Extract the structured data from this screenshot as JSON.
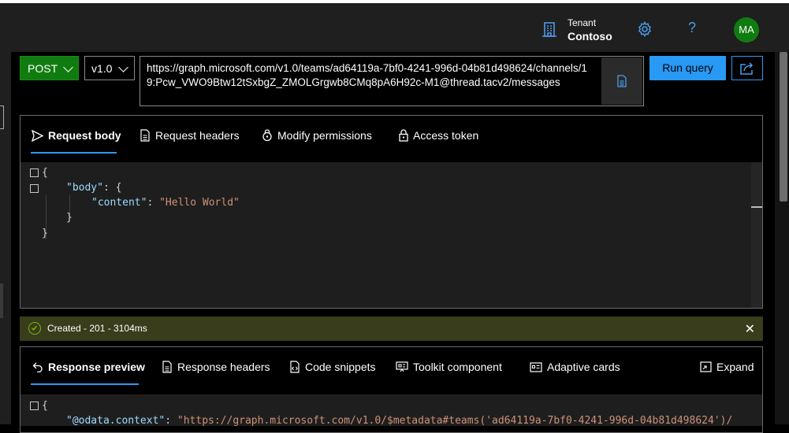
{
  "header": {
    "tenant_label": "Tenant",
    "tenant_name": "Contoso",
    "help_glyph": "?",
    "avatar_initials": "MA",
    "icons": {
      "tenant": "building-icon",
      "settings": "gear-icon",
      "help": "question-icon"
    }
  },
  "query": {
    "method": "POST",
    "version": "v1.0",
    "url": "https://graph.microsoft.com/v1.0/teams/ad64119a-7bf0-4241-996d-04b81d498624/channels/19:Pcw_VWO9Btw12tSxbgZ_ZMOLGrgwb8CMq8pA6H92c-M1@thread.tacv2/messages",
    "run_label": "Run query"
  },
  "request": {
    "tabs": [
      {
        "label": "Request body",
        "icon": "send-icon",
        "active": true
      },
      {
        "label": "Request headers",
        "icon": "document-icon",
        "active": false
      },
      {
        "label": "Modify permissions",
        "icon": "lock-shield-icon",
        "active": false
      },
      {
        "label": "Access token",
        "icon": "lock-icon",
        "active": false
      }
    ],
    "body_lines": [
      "{",
      "\"body\": {",
      "\"content\": \"Hello World\"",
      "}",
      "}"
    ],
    "body_key": "\"body\"",
    "content_key": "\"content\"",
    "content_value": "\"Hello World\""
  },
  "status": {
    "text": "Created - 201 - 3104ms",
    "close_glyph": "✕"
  },
  "response": {
    "tabs": [
      {
        "label": "Response preview",
        "icon": "return-arrow-icon",
        "active": true
      },
      {
        "label": "Response headers",
        "icon": "document-icon",
        "active": false
      },
      {
        "label": "Code snippets",
        "icon": "code-document-icon",
        "active": false
      },
      {
        "label": "Toolkit component",
        "icon": "toolkit-icon",
        "active": false
      },
      {
        "label": "Adaptive cards",
        "icon": "card-icon",
        "active": false
      }
    ],
    "expand_label": "Expand",
    "body_open": "{",
    "odata_key": "\"@odata.context\"",
    "odata_value": "\"https://graph.microsoft.com/v1.0/$metadata#teams('ad64119a-7bf0-4241-996d-04b81d498624')/"
  },
  "colors": {
    "accent": "#2899f5",
    "method_green": "#107c10",
    "success_banner": "#393d1b",
    "json_key": "#9cdcfe",
    "json_string": "#ce9178"
  }
}
